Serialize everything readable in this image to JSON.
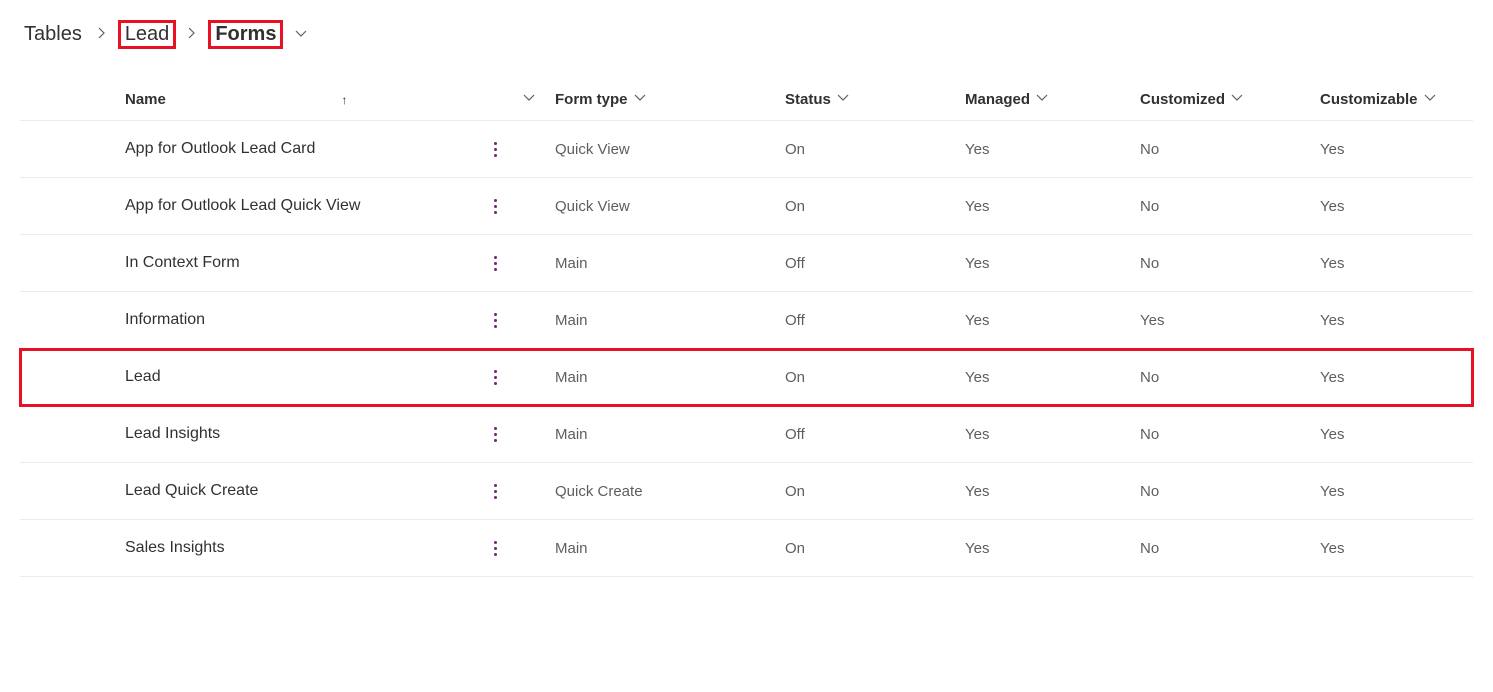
{
  "breadcrumb": {
    "tables": "Tables",
    "lead": "Lead",
    "forms": "Forms"
  },
  "columns": {
    "name": "Name",
    "formtype": "Form type",
    "status": "Status",
    "managed": "Managed",
    "customized": "Customized",
    "customizable": "Customizable"
  },
  "rows": [
    {
      "name": "App for Outlook Lead Card",
      "formtype": "Quick View",
      "status": "On",
      "managed": "Yes",
      "customized": "No",
      "customizable": "Yes",
      "highlighted": false
    },
    {
      "name": "App for Outlook Lead Quick View",
      "formtype": "Quick View",
      "status": "On",
      "managed": "Yes",
      "customized": "No",
      "customizable": "Yes",
      "highlighted": false
    },
    {
      "name": "In Context Form",
      "formtype": "Main",
      "status": "Off",
      "managed": "Yes",
      "customized": "No",
      "customizable": "Yes",
      "highlighted": false
    },
    {
      "name": "Information",
      "formtype": "Main",
      "status": "Off",
      "managed": "Yes",
      "customized": "Yes",
      "customizable": "Yes",
      "highlighted": false
    },
    {
      "name": "Lead",
      "formtype": "Main",
      "status": "On",
      "managed": "Yes",
      "customized": "No",
      "customizable": "Yes",
      "highlighted": true
    },
    {
      "name": "Lead Insights",
      "formtype": "Main",
      "status": "Off",
      "managed": "Yes",
      "customized": "No",
      "customizable": "Yes",
      "highlighted": false
    },
    {
      "name": "Lead Quick Create",
      "formtype": "Quick Create",
      "status": "On",
      "managed": "Yes",
      "customized": "No",
      "customizable": "Yes",
      "highlighted": false
    },
    {
      "name": "Sales Insights",
      "formtype": "Main",
      "status": "On",
      "managed": "Yes",
      "customized": "No",
      "customizable": "Yes",
      "highlighted": false
    }
  ]
}
